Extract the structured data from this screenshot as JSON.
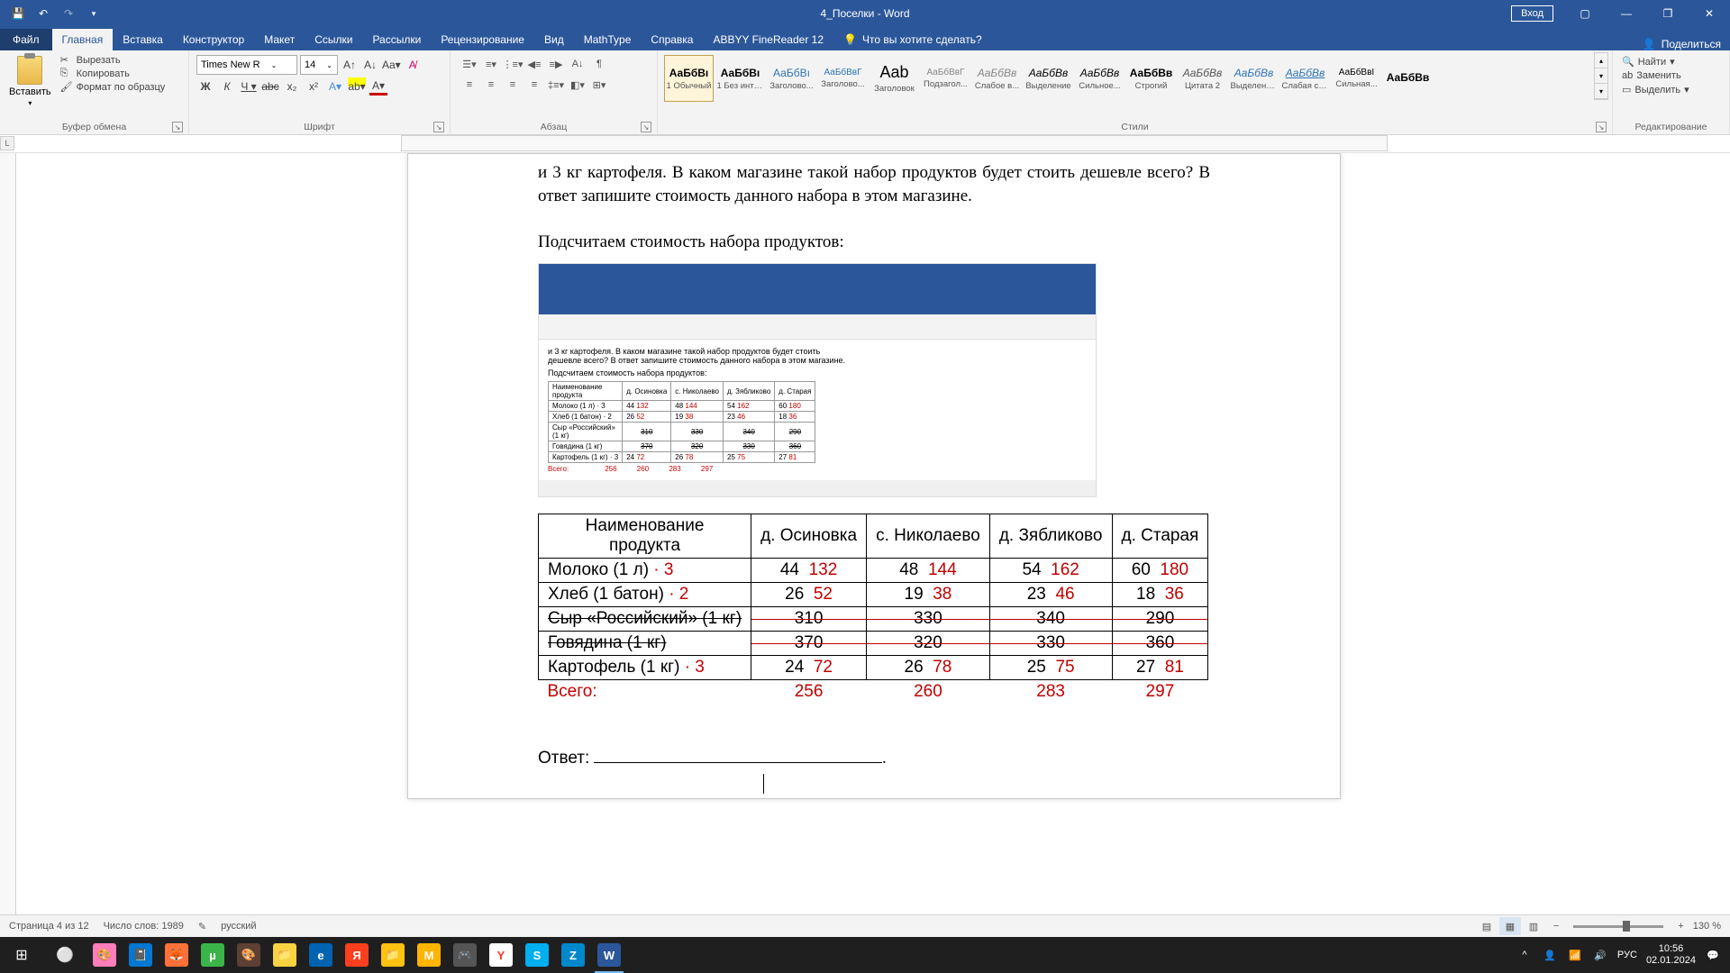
{
  "title": "4_Поселки - Word",
  "signin": "Вход",
  "share": "Поделиться",
  "tabs": {
    "file": "Файл",
    "home": "Главная",
    "insert": "Вставка",
    "design": "Конструктор",
    "layout": "Макет",
    "references": "Ссылки",
    "mailings": "Рассылки",
    "review": "Рецензирование",
    "view": "Вид",
    "mathtype": "MathType",
    "help": "Справка",
    "abbyy": "ABBYY FineReader 12",
    "tellme": "Что вы хотите сделать?"
  },
  "clipboard": {
    "paste": "Вставить",
    "cut": "Вырезать",
    "copy": "Копировать",
    "format": "Формат по образцу",
    "label": "Буфер обмена"
  },
  "font": {
    "name": "Times New R",
    "size": "14",
    "label": "Шрифт"
  },
  "paragraph": {
    "label": "Абзац"
  },
  "styles": {
    "label": "Стили",
    "items": [
      {
        "preview": "АаБбВı",
        "name": "1 Обычный",
        "bold": true
      },
      {
        "preview": "АаБбВı",
        "name": "1 Без инте...",
        "bold": true
      },
      {
        "preview": "АаБбВı",
        "name": "Заголово...",
        "color": "#2e74b5"
      },
      {
        "preview": "АаБбВвГ",
        "name": "Заголово...",
        "color": "#2e74b5",
        "small": true
      },
      {
        "preview": "Aab",
        "name": "Заголовок",
        "color": "#000",
        "big": true
      },
      {
        "preview": "АаБбВвГ",
        "name": "Подзагол...",
        "color": "#888",
        "small": true
      },
      {
        "preview": "АаБбВв",
        "name": "Слабое в...",
        "color": "#888",
        "italic": true
      },
      {
        "preview": "АаБбВв",
        "name": "Выделение",
        "italic": true
      },
      {
        "preview": "АаБбВв",
        "name": "Сильное...",
        "italic": true
      },
      {
        "preview": "АаБбВв",
        "name": "Строгий",
        "bold": true
      },
      {
        "preview": "АаБбВв",
        "name": "Цитата 2",
        "italic": true,
        "color": "#555"
      },
      {
        "preview": "АаБбВв",
        "name": "Выделенн...",
        "italic": true,
        "color": "#2e74b5"
      },
      {
        "preview": "АаБбВв",
        "name": "Слабая сс...",
        "color": "#2e74b5",
        "underline": true,
        "italic": true
      },
      {
        "preview": "АаБбВвІ",
        "name": "Сильная...",
        "small": true
      },
      {
        "preview": "АаБбВв",
        "name": "",
        "bold": true
      }
    ]
  },
  "editing": {
    "find": "Найти",
    "replace": "Заменить",
    "select": "Выделить",
    "label": "Редактирование"
  },
  "document": {
    "p1": "и 3 кг картофеля. В каком магазине такой набор продуктов будет стоить дешевле всего? В ответ запишите стоимость данного набора в этом магазине.",
    "p2": "Подсчитаем стоимость набора продуктов:",
    "answer_label": "Ответ:",
    "table": {
      "head": [
        "Наименование продукта",
        "д. Осиновка",
        "с. Николаево",
        "д. Зябликово",
        "д. Старая"
      ],
      "rows": [
        {
          "name": "Молоко (1 л)",
          "mult": "· 3",
          "v": [
            [
              "44",
              "132"
            ],
            [
              "48",
              "144"
            ],
            [
              "54",
              "162"
            ],
            [
              "60",
              "180"
            ]
          ]
        },
        {
          "name": "Хлеб (1 батон)",
          "mult": "· 2",
          "v": [
            [
              "26",
              "52"
            ],
            [
              "19",
              "38"
            ],
            [
              "23",
              "46"
            ],
            [
              "18",
              "36"
            ]
          ]
        },
        {
          "name": "Сыр «Российский» (1 кг)",
          "strike": true,
          "v": [
            [
              "310"
            ],
            [
              "330"
            ],
            [
              "340"
            ],
            [
              "290"
            ]
          ]
        },
        {
          "name": "Говядина (1 кг)",
          "strike": true,
          "v": [
            [
              "370"
            ],
            [
              "320"
            ],
            [
              "330"
            ],
            [
              "360"
            ]
          ]
        },
        {
          "name": "Картофель (1 кг)",
          "mult": "· 3",
          "v": [
            [
              "24",
              "72"
            ],
            [
              "26",
              "78"
            ],
            [
              "25",
              "75"
            ],
            [
              "27",
              "81"
            ]
          ]
        }
      ],
      "total_label": "Всего:",
      "totals": [
        "256",
        "260",
        "283",
        "297"
      ]
    }
  },
  "status": {
    "page": "Страница 4 из 12",
    "words": "Число слов: 1989",
    "lang": "русский",
    "zoom": "130 %"
  },
  "taskbar": {
    "time": "10:56",
    "date": "02.01.2024",
    "ime": "РУС"
  }
}
